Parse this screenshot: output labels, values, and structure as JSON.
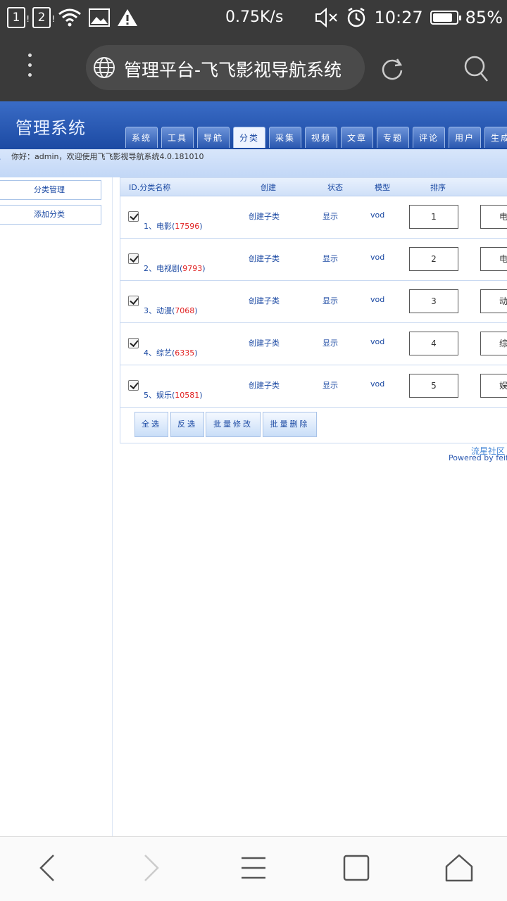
{
  "statusbar": {
    "sim1": "1",
    "sim2": "2",
    "net_speed": "0.75K/s",
    "time": "10:27",
    "battery": "85%",
    "battery_level": 0.85
  },
  "browser": {
    "tab_title": "管理平台-飞飞影视导航系统"
  },
  "header": {
    "title": "管理系统",
    "nav_tabs": [
      "系统",
      "工具",
      "导航",
      "分类",
      "采集",
      "视频",
      "文章",
      "专题",
      "评论",
      "用户",
      "生成"
    ],
    "active_tab": "分类"
  },
  "welcome": {
    "text": "你好：admin，欢迎使用飞飞影视导航系统4.0.181010"
  },
  "sidebar": {
    "items": [
      "分类管理",
      "添加分类"
    ]
  },
  "table": {
    "headers": {
      "id_name": "ID.分类名称",
      "create": "创建",
      "status": "状态",
      "model": "模型",
      "order": "排序"
    },
    "rows": [
      {
        "label": "1、电影",
        "count": "17596",
        "create": "创建子类",
        "status": "显示",
        "model": "vod",
        "order": "1",
        "extra": "电"
      },
      {
        "label": "2、电视剧",
        "count": "9793",
        "create": "创建子类",
        "status": "显示",
        "model": "vod",
        "order": "2",
        "extra": "电"
      },
      {
        "label": "3、动漫",
        "count": "7068",
        "create": "创建子类",
        "status": "显示",
        "model": "vod",
        "order": "3",
        "extra": "动"
      },
      {
        "label": "4、综艺",
        "count": "6335",
        "create": "创建子类",
        "status": "显示",
        "model": "vod",
        "order": "4",
        "extra": "综"
      },
      {
        "label": "5、娱乐",
        "count": "10581",
        "create": "创建子类",
        "status": "显示",
        "model": "vod",
        "order": "5",
        "extra": "娱"
      }
    ],
    "buttons": {
      "select_all": "全选",
      "invert": "反选",
      "batch_edit": "批量修改",
      "batch_delete": "批量删除"
    }
  },
  "footer": {
    "line1": "流星社区",
    "line2": "Powered by feifeicms"
  }
}
